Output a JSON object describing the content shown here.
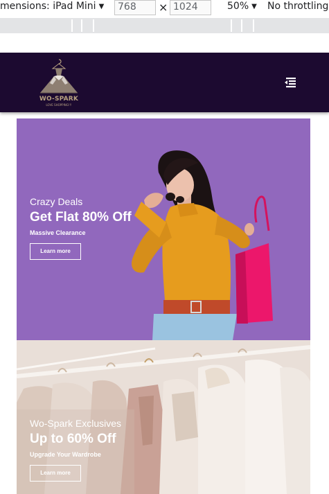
{
  "devtools": {
    "dimensions_label": "mensions: iPad Mini",
    "width_value": "768",
    "times_symbol": "×",
    "height_value": "1024",
    "zoom": "50%",
    "throttling": "No throttling",
    "caret": "▼"
  },
  "header": {
    "brand": "WO-SPARK",
    "tagline": "LOVE SHOPPING!!!",
    "menu_icon": "menu-collapse-icon",
    "background_color": "#1c0a30"
  },
  "banners": [
    {
      "kicker": "Crazy Deals",
      "headline": "Get Flat 80% Off",
      "sub": "Massive Clearance",
      "cta": "Learn more",
      "background_color": "#9168bd"
    },
    {
      "kicker": "Wo-Spark Exclusives",
      "headline": "Up to 60% Off",
      "sub": "Upgrade Your Wardrobe",
      "cta": "Learn more",
      "background_color": "#ece3de"
    }
  ]
}
